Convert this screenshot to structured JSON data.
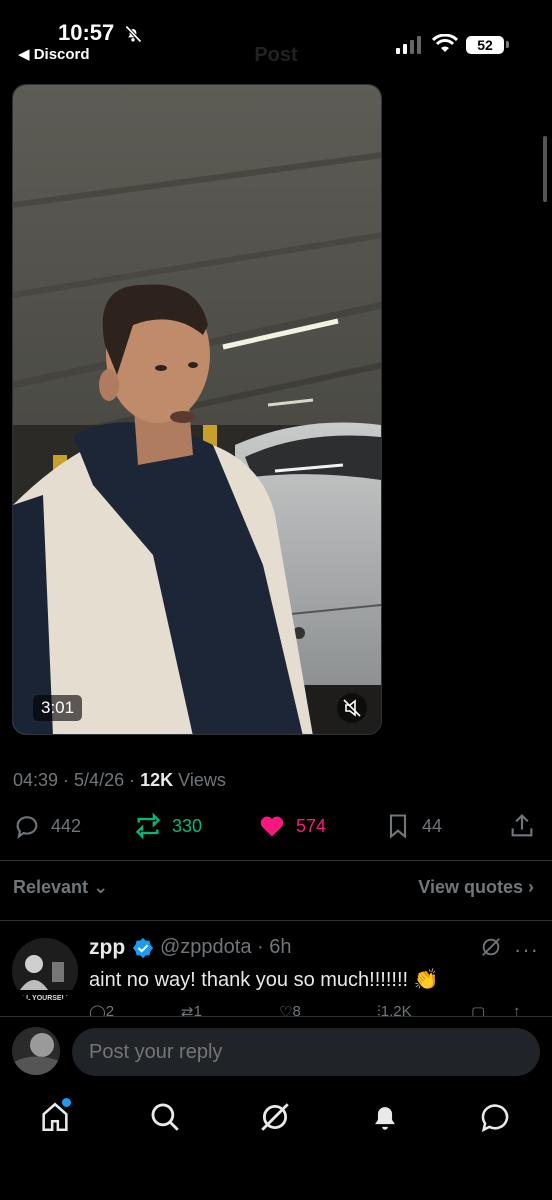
{
  "status_bar": {
    "time": "10:57",
    "back_app": "Discord",
    "battery": "52"
  },
  "header": {
    "title": "Post"
  },
  "video": {
    "duration": "3:01"
  },
  "post_meta": {
    "time": "04:39",
    "date": "5/4/26",
    "views_count": "12K",
    "views_label": "Views"
  },
  "actions": {
    "replies": "442",
    "reposts": "330",
    "likes": "574",
    "bookmarks": "44"
  },
  "sort": {
    "label": "Relevant",
    "view_quotes": "View quotes"
  },
  "reply": {
    "name": "zpp",
    "handle_time": "@zppdota · 6h",
    "text": "aint no way! thank you so much!!!!!!!  👏",
    "stats": {
      "replies": "2",
      "reposts": "1",
      "likes": "8",
      "views": "1.2K"
    }
  },
  "compose": {
    "placeholder": "Post your reply"
  },
  "colors": {
    "background": "#000000",
    "secondary_text": "#71767b",
    "repost_green": "#00ba7c",
    "like_pink": "#f91880",
    "verified_blue": "#1d9bf0"
  }
}
